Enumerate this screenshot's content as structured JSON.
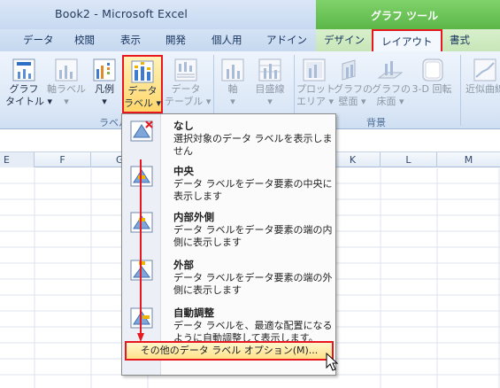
{
  "window": {
    "title": "Book2 - Microsoft Excel"
  },
  "contextual_tab_group": {
    "label": "グラフ ツール",
    "color": "#5bb748"
  },
  "tabs": [
    {
      "label": "データ"
    },
    {
      "label": "校閲"
    },
    {
      "label": "表示"
    },
    {
      "label": "開発"
    },
    {
      "label": "個人用"
    },
    {
      "label": "アドイン"
    },
    {
      "label": "デザイン"
    },
    {
      "label": "レイアウト",
      "active": true
    },
    {
      "label": "書式"
    }
  ],
  "ribbon": {
    "graph_title": {
      "line1": "グラフ",
      "line2": "タイトル ▾"
    },
    "axis_label": {
      "line1": "軸ラベル",
      "line2": "▾"
    },
    "legend": {
      "line1": "凡例",
      "line2": "▾"
    },
    "data_label": {
      "line1": "データ",
      "line2": "ラベル ▾",
      "selected": true
    },
    "data_table": {
      "line1": "データ",
      "line2": "テーブル ▾"
    },
    "axes": {
      "line1": "軸",
      "line2": "▾"
    },
    "gridlines": {
      "line1": "目盛線",
      "line2": "▾"
    },
    "plot_area": {
      "line1": "プロット",
      "line2": "エリア ▾"
    },
    "chart_wall": {
      "line1": "グラフの",
      "line2": "壁面 ▾"
    },
    "chart_floor": {
      "line1": "グラフの",
      "line2": "床面 ▾"
    },
    "rotate_3d": {
      "line1": "3-D 回転",
      "line2": ""
    },
    "trendline": {
      "line1": "近似曲線",
      "line2": ""
    },
    "group_labels": {
      "labels": "ラベル",
      "background": "背景"
    }
  },
  "columns": [
    "E",
    "F",
    "G",
    "K",
    "L",
    "M"
  ],
  "menu": {
    "items": [
      {
        "title": "なし",
        "desc": "選択対象のデータ ラベルを表示しません"
      },
      {
        "title": "中央",
        "desc": "データ ラベルをデータ要素の中央に表示します"
      },
      {
        "title": "内部外側",
        "desc": "データ ラベルをデータ要素の端の内側に表示します"
      },
      {
        "title": "外部",
        "desc": "データ ラベルをデータ要素の端の外側に表示します"
      },
      {
        "title": "自動調整",
        "desc": "データ ラベルを、最適な配置になるように自動調整して表示します。"
      }
    ],
    "more_options": "その他のデータ ラベル オプション(M)..."
  },
  "colors": {
    "highlight_border": "#e8161e",
    "hover_fill": "#ffe28a",
    "ribbon_blue": "#dce8f7"
  }
}
